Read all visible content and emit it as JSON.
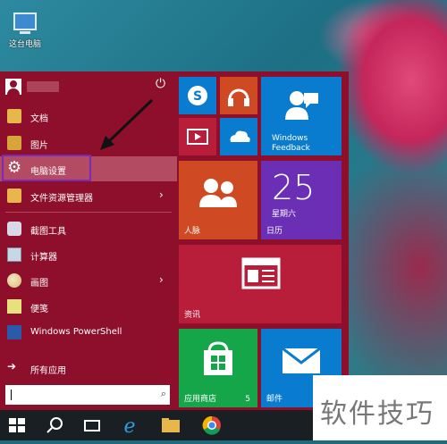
{
  "desktop": {
    "this_pc_label": "这台电脑"
  },
  "start_menu": {
    "left_items": [
      {
        "label": "文档"
      },
      {
        "label": "图片"
      },
      {
        "label": "电脑设置"
      },
      {
        "label": "文件资源管理器"
      },
      {
        "label": "截图工具"
      },
      {
        "label": "计算器"
      },
      {
        "label": "画图"
      },
      {
        "label": "便笺"
      },
      {
        "label": "Windows PowerShell"
      }
    ],
    "all_apps_label": "所有应用"
  },
  "tiles": {
    "feedback": "Windows Feedback",
    "people": "人脉",
    "calendar_day": "25",
    "calendar_weekday": "星期六",
    "calendar": "日历",
    "news": "资讯",
    "store": "应用商店",
    "store_badge": "5",
    "mail": "邮件"
  },
  "watermark": "软件技巧",
  "colors": {
    "start_bg": "#8e0f2b",
    "selection_border": "#7a2bb5",
    "tile_blue": "#0a7cd0"
  }
}
